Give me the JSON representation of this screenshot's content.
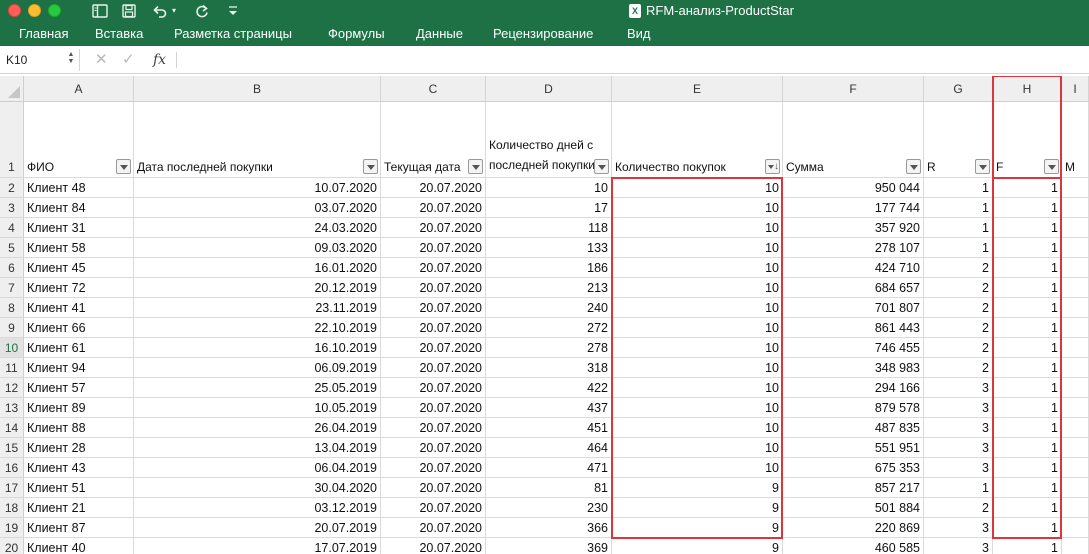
{
  "window": {
    "title": "RFM-анализ-ProductStar"
  },
  "quick_access": {
    "icons": [
      "sidebar-icon",
      "save-icon",
      "undo-icon",
      "redo-icon",
      "customize-icon"
    ]
  },
  "ribbon": {
    "tabs": [
      "Главная",
      "Вставка",
      "Разметка страницы",
      "Формулы",
      "Данные",
      "Рецензирование",
      "Вид"
    ]
  },
  "formula_bar": {
    "name_box": "K10",
    "fx_label": "fx",
    "formula": ""
  },
  "sheet": {
    "columns": [
      "A",
      "B",
      "C",
      "D",
      "E",
      "F",
      "G",
      "H",
      "I"
    ],
    "header_row_number": "1",
    "headers": {
      "A": "ФИО",
      "B": "Дата последней покупки",
      "C": "Текущая дата",
      "D": "Количество дней с последней покупки",
      "E": "Количество покупок",
      "F": "Сумма",
      "G": "R",
      "H": "F",
      "I": "M"
    },
    "active_row": "10",
    "rows": [
      {
        "n": "2",
        "a": "Клиент 48",
        "b": "10.07.2020",
        "c": "20.07.2020",
        "d": "10",
        "e": "10",
        "f": "950 044",
        "g": "1",
        "h": "1"
      },
      {
        "n": "3",
        "a": "Клиент 84",
        "b": "03.07.2020",
        "c": "20.07.2020",
        "d": "17",
        "e": "10",
        "f": "177 744",
        "g": "1",
        "h": "1"
      },
      {
        "n": "4",
        "a": "Клиент 31",
        "b": "24.03.2020",
        "c": "20.07.2020",
        "d": "118",
        "e": "10",
        "f": "357 920",
        "g": "1",
        "h": "1"
      },
      {
        "n": "5",
        "a": "Клиент 58",
        "b": "09.03.2020",
        "c": "20.07.2020",
        "d": "133",
        "e": "10",
        "f": "278 107",
        "g": "1",
        "h": "1"
      },
      {
        "n": "6",
        "a": "Клиент 45",
        "b": "16.01.2020",
        "c": "20.07.2020",
        "d": "186",
        "e": "10",
        "f": "424 710",
        "g": "2",
        "h": "1"
      },
      {
        "n": "7",
        "a": "Клиент 72",
        "b": "20.12.2019",
        "c": "20.07.2020",
        "d": "213",
        "e": "10",
        "f": "684 657",
        "g": "2",
        "h": "1"
      },
      {
        "n": "8",
        "a": "Клиент 41",
        "b": "23.11.2019",
        "c": "20.07.2020",
        "d": "240",
        "e": "10",
        "f": "701 807",
        "g": "2",
        "h": "1"
      },
      {
        "n": "9",
        "a": "Клиент 66",
        "b": "22.10.2019",
        "c": "20.07.2020",
        "d": "272",
        "e": "10",
        "f": "861 443",
        "g": "2",
        "h": "1"
      },
      {
        "n": "10",
        "a": "Клиент 61",
        "b": "16.10.2019",
        "c": "20.07.2020",
        "d": "278",
        "e": "10",
        "f": "746 455",
        "g": "2",
        "h": "1"
      },
      {
        "n": "11",
        "a": "Клиент 94",
        "b": "06.09.2019",
        "c": "20.07.2020",
        "d": "318",
        "e": "10",
        "f": "348 983",
        "g": "2",
        "h": "1"
      },
      {
        "n": "12",
        "a": "Клиент 57",
        "b": "25.05.2019",
        "c": "20.07.2020",
        "d": "422",
        "e": "10",
        "f": "294 166",
        "g": "3",
        "h": "1"
      },
      {
        "n": "13",
        "a": "Клиент 89",
        "b": "10.05.2019",
        "c": "20.07.2020",
        "d": "437",
        "e": "10",
        "f": "879 578",
        "g": "3",
        "h": "1"
      },
      {
        "n": "14",
        "a": "Клиент 88",
        "b": "26.04.2019",
        "c": "20.07.2020",
        "d": "451",
        "e": "10",
        "f": "487 835",
        "g": "3",
        "h": "1"
      },
      {
        "n": "15",
        "a": "Клиент 28",
        "b": "13.04.2019",
        "c": "20.07.2020",
        "d": "464",
        "e": "10",
        "f": "551 951",
        "g": "3",
        "h": "1"
      },
      {
        "n": "16",
        "a": "Клиент 43",
        "b": "06.04.2019",
        "c": "20.07.2020",
        "d": "471",
        "e": "10",
        "f": "675 353",
        "g": "3",
        "h": "1"
      },
      {
        "n": "17",
        "a": "Клиент 51",
        "b": "30.04.2020",
        "c": "20.07.2020",
        "d": "81",
        "e": "9",
        "f": "857 217",
        "g": "1",
        "h": "1"
      },
      {
        "n": "18",
        "a": "Клиент 21",
        "b": "03.12.2019",
        "c": "20.07.2020",
        "d": "230",
        "e": "9",
        "f": "501 884",
        "g": "2",
        "h": "1"
      },
      {
        "n": "19",
        "a": "Клиент 87",
        "b": "20.07.2019",
        "c": "20.07.2020",
        "d": "366",
        "e": "9",
        "f": "220 869",
        "g": "3",
        "h": "1"
      },
      {
        "n": "20",
        "a": "Клиент 40",
        "b": "17.07.2019",
        "c": "20.07.2020",
        "d": "369",
        "e": "9",
        "f": "460 585",
        "g": "3",
        "h": "1"
      }
    ]
  },
  "colors": {
    "ribbon": "#1e7145",
    "highlight": "#d9363e"
  }
}
